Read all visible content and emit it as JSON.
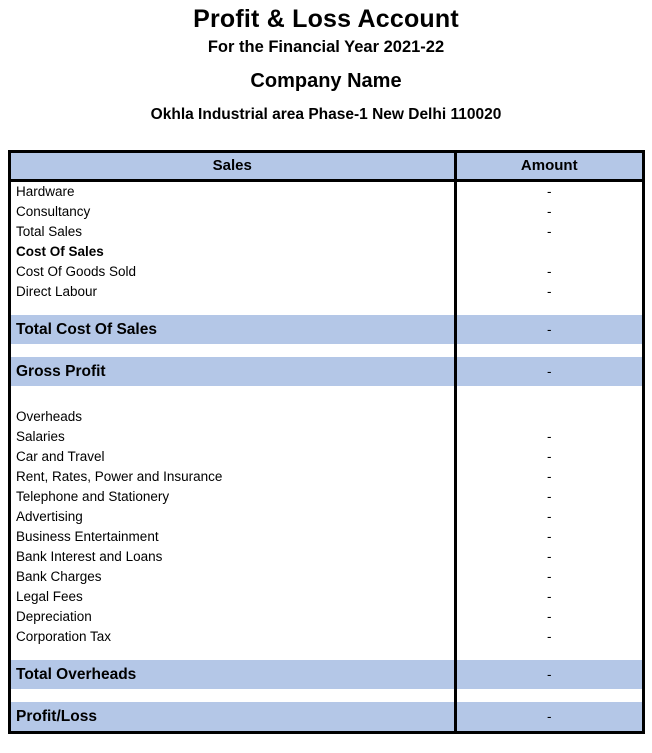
{
  "document": {
    "title": "Profit & Loss Account",
    "subtitle": "For the Financial Year 2021-22",
    "company_name": "Company Name",
    "company_address": "Okhla Industrial area Phase-1 New Delhi 110020"
  },
  "colors": {
    "band_blue": "#b4c7e7",
    "border_black": "#000000",
    "page_background": "#ffffff"
  },
  "table": {
    "columns": [
      {
        "key": "label",
        "header": "Sales"
      },
      {
        "key": "amount",
        "header": "Amount"
      }
    ],
    "rows": [
      {
        "type": "data",
        "label": "Hardware",
        "amount": "-",
        "bold": false
      },
      {
        "type": "data",
        "label": "Consultancy",
        "amount": "-",
        "bold": false
      },
      {
        "type": "data",
        "label": "Total Sales",
        "amount": "-",
        "bold": false
      },
      {
        "type": "data",
        "label": "Cost Of Sales",
        "amount": "",
        "bold": true
      },
      {
        "type": "data",
        "label": "Cost Of Goods Sold",
        "amount": "-",
        "bold": false
      },
      {
        "type": "data",
        "label": "Direct Labour",
        "amount": "-",
        "bold": false
      },
      {
        "type": "spacer",
        "label": "",
        "amount": ""
      },
      {
        "type": "total",
        "label": "Total Cost Of Sales",
        "amount": "-"
      },
      {
        "type": "spacer",
        "label": "",
        "amount": ""
      },
      {
        "type": "total",
        "label": "Gross Profit",
        "amount": "-"
      },
      {
        "type": "spacer",
        "label": "",
        "amount": "",
        "tall": true
      },
      {
        "type": "data",
        "label": "Overheads",
        "amount": "",
        "bold": false
      },
      {
        "type": "data",
        "label": "Salaries",
        "amount": "-",
        "bold": false
      },
      {
        "type": "data",
        "label": "Car and Travel",
        "amount": "-",
        "bold": false
      },
      {
        "type": "data",
        "label": "Rent, Rates, Power and Insurance",
        "amount": "-",
        "bold": false
      },
      {
        "type": "data",
        "label": "Telephone and Stationery",
        "amount": "-",
        "bold": false
      },
      {
        "type": "data",
        "label": "Advertising",
        "amount": "-",
        "bold": false
      },
      {
        "type": "data",
        "label": "Business Entertainment",
        "amount": "-",
        "bold": false
      },
      {
        "type": "data",
        "label": "Bank Interest and Loans",
        "amount": "-",
        "bold": false
      },
      {
        "type": "data",
        "label": "Bank Charges",
        "amount": "-",
        "bold": false
      },
      {
        "type": "data",
        "label": "Legal Fees",
        "amount": "-",
        "bold": false
      },
      {
        "type": "data",
        "label": "Depreciation",
        "amount": "-",
        "bold": false
      },
      {
        "type": "data",
        "label": "Corporation Tax",
        "amount": "-",
        "bold": false
      },
      {
        "type": "spacer",
        "label": "",
        "amount": ""
      },
      {
        "type": "total",
        "label": "Total Overheads",
        "amount": "-"
      },
      {
        "type": "spacer",
        "label": "",
        "amount": ""
      },
      {
        "type": "total",
        "label": "Profit/Loss",
        "amount": "-",
        "last": true
      }
    ]
  }
}
